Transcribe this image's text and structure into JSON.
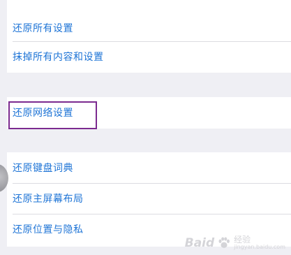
{
  "settings": {
    "group1": [
      {
        "label": "还原所有设置"
      },
      {
        "label": "抹掉所有内容和设置"
      }
    ],
    "group2": [
      {
        "label": "还原网络设置"
      }
    ],
    "group3": [
      {
        "label": "还原键盘词典"
      },
      {
        "label": "还原主屏幕布局"
      },
      {
        "label": "还原位置与隐私"
      }
    ]
  },
  "highlight_color": "#7b2a8f",
  "label_color": "#1e74d6",
  "watermark": {
    "brand": "Baid",
    "sub_cn": "经验",
    "sub_url": "jingyan.baidu.com"
  }
}
